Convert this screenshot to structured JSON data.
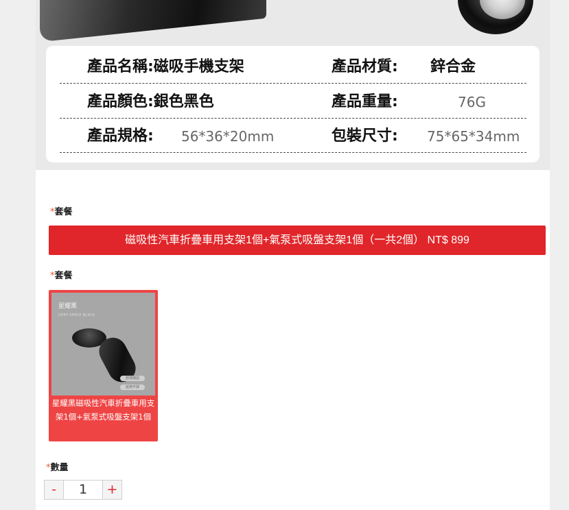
{
  "specs": {
    "rows": [
      {
        "label1": "產品名稱:磁吸手機支架",
        "label2": "產品材質:",
        "value2": "鋅合金"
      },
      {
        "label1": "產品顏色:銀色黑色",
        "label2": "產品重量:",
        "value2": "76G"
      },
      {
        "label1": "產品規格:",
        "value1": "56*36*20mm",
        "label2": "包裝尺寸:",
        "value2": "75*65*34mm"
      }
    ]
  },
  "package_field": {
    "star": "*",
    "label": "套餐",
    "selected_option": "磁吸性汽車折疊車用支架1個+氣泵式吸盤支架1個（一共2個） NT$ 899"
  },
  "variant_field": {
    "star": "*",
    "label": "套餐",
    "option": {
      "image_title": "星耀黑",
      "image_subtitle": "DEEP SPACE BLACK",
      "image_tag1": "舒適穩固",
      "image_tag2": "延用不掉",
      "caption": "星耀黑磁吸性汽車折疊車用支架1個+氣泵式吸盤支架1個"
    }
  },
  "quantity_field": {
    "star": "*",
    "label": "數量",
    "minus": "-",
    "value": "1",
    "plus": "+"
  },
  "colors": {
    "accent_red": "#e0262a",
    "option_red": "#ef4444",
    "star_orange": "#e65a2a"
  }
}
